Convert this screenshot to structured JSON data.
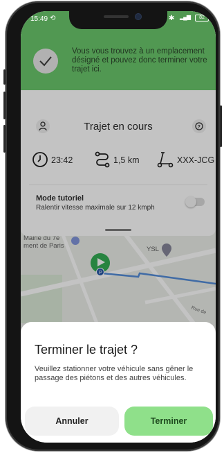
{
  "status_bar": {
    "time": "15:49",
    "battery": "82",
    "rotate_icon": "screen-rotate-icon",
    "bluetooth_icon": "bluetooth-icon",
    "signal_icon": "signal-icon"
  },
  "banner": {
    "message": "Vous vous trouvez à un emplacement désigné et pouvez donc terminer votre trajet ici.",
    "icon": "check-icon",
    "color": "#62c463"
  },
  "trip_card": {
    "title": "Trajet en cours",
    "duration": "23:42",
    "distance": "1,5 km",
    "vehicle_id": "XXX-JCG",
    "tutorial_title": "Mode tutoriel",
    "tutorial_subtitle": "Ralentir vitesse maximale sur 12 kmph",
    "tutorial_enabled": false
  },
  "map": {
    "label_mairie": "Mairie du 7e",
    "label_paris": "ment de Paris",
    "label_ysl": "YSL",
    "label_street": "Rue de"
  },
  "dialog": {
    "heading": "Terminer le trajet ?",
    "body": "Veuillez stationner votre véhicule sans gêner le passage des piétons et des autres véhicules.",
    "cancel_label": "Annuler",
    "confirm_label": "Terminer",
    "confirm_color": "#8fe08a"
  }
}
